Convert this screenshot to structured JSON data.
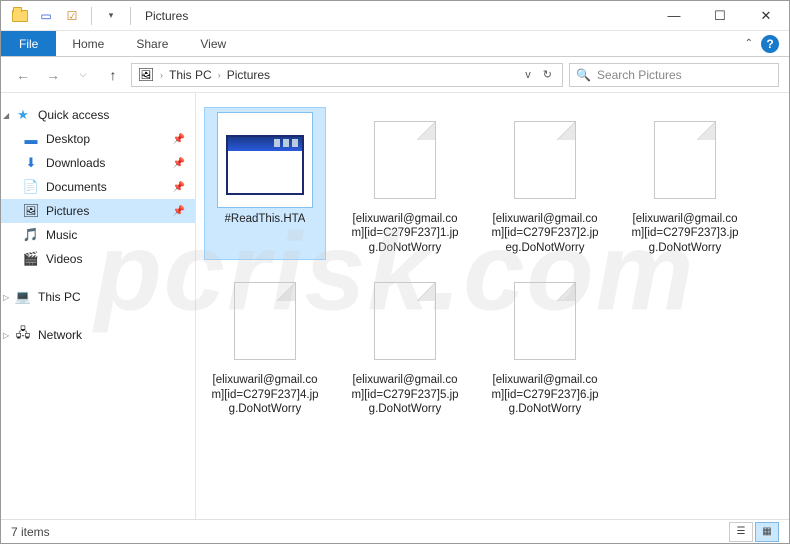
{
  "titlebar": {
    "title": "Pictures"
  },
  "ribbon": {
    "file": "File",
    "tabs": [
      "Home",
      "Share",
      "View"
    ]
  },
  "breadcrumb": {
    "segments": [
      "This PC",
      "Pictures"
    ]
  },
  "search": {
    "placeholder": "Search Pictures"
  },
  "sidebar": {
    "quick_access": "Quick access",
    "items": [
      {
        "label": "Desktop",
        "pinned": true
      },
      {
        "label": "Downloads",
        "pinned": true
      },
      {
        "label": "Documents",
        "pinned": true
      },
      {
        "label": "Pictures",
        "pinned": true,
        "selected": true
      },
      {
        "label": "Music",
        "pinned": false
      },
      {
        "label": "Videos",
        "pinned": false
      }
    ],
    "this_pc": "This PC",
    "network": "Network"
  },
  "files": [
    {
      "name": "#ReadThis.HTA",
      "type": "hta",
      "selected": true
    },
    {
      "name": "[elixuwaril@gmail.com][id=C279F237]1.jpg.DoNotWorry",
      "type": "generic"
    },
    {
      "name": "[elixuwaril@gmail.com][id=C279F237]2.jpeg.DoNotWorry",
      "type": "generic"
    },
    {
      "name": "[elixuwaril@gmail.com][id=C279F237]3.jpg.DoNotWorry",
      "type": "generic"
    },
    {
      "name": "[elixuwaril@gmail.com][id=C279F237]4.jpg.DoNotWorry",
      "type": "generic"
    },
    {
      "name": "[elixuwaril@gmail.com][id=C279F237]5.jpg.DoNotWorry",
      "type": "generic"
    },
    {
      "name": "[elixuwaril@gmail.com][id=C279F237]6.jpg.DoNotWorry",
      "type": "generic"
    }
  ],
  "status": {
    "count": "7 items"
  },
  "watermark": "pcrisk.com",
  "icons": {
    "star": "★",
    "desktop": "🖥",
    "download": "⬇",
    "document": "📄",
    "picture": "🖼",
    "music": "🎵",
    "video": "🎬",
    "pc": "💻",
    "network": "🖧",
    "search": "🔍",
    "refresh": "↻",
    "dropdown": "v"
  }
}
